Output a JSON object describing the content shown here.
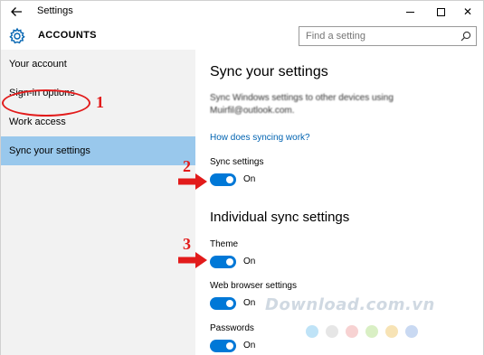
{
  "window": {
    "title": "Settings",
    "back_icon": "back-arrow-icon",
    "minimize_icon": "minimize-icon",
    "maximize_icon": "maximize-icon",
    "close_icon": "close-icon",
    "close_glyph": "✕"
  },
  "header": {
    "icon": "gear-icon",
    "title": "ACCOUNTS",
    "search_placeholder": "Find a setting",
    "search_icon": "search-icon"
  },
  "sidebar": {
    "items": [
      {
        "label": "Your account",
        "selected": false
      },
      {
        "label": "Sign-in options",
        "selected": false
      },
      {
        "label": "Work access",
        "selected": false
      },
      {
        "label": "Sync your settings",
        "selected": true
      }
    ],
    "selected_color": "#99c8ec",
    "background": "#f2f2f2"
  },
  "main": {
    "heading": "Sync your settings",
    "description_line1": "Sync Windows settings to other devices using",
    "description_line2": "Muirfil@outlook.com.",
    "link": "How does syncing work?",
    "sync_settings": {
      "label": "Sync settings",
      "state": "On",
      "on": true
    },
    "individual_heading": "Individual sync settings",
    "individual": [
      {
        "label": "Theme",
        "state": "On",
        "on": true
      },
      {
        "label": "Web browser settings",
        "state": "On",
        "on": true
      },
      {
        "label": "Passwords",
        "state": "On",
        "on": true
      }
    ],
    "toggle_color": "#0078d7",
    "link_color": "#0063b1"
  },
  "annotations": {
    "color": "#e21b1b",
    "numbers": [
      "1",
      "2",
      "3"
    ],
    "arrow_icon": "red-arrow-icon"
  },
  "watermark": {
    "text": "Download.com.vn",
    "dot_colors": [
      "#bfe3f7",
      "#e6e6e6",
      "#f7d2d2",
      "#d9efc4",
      "#f7e3b5",
      "#c9d9f2",
      "#d8c8ec"
    ]
  }
}
